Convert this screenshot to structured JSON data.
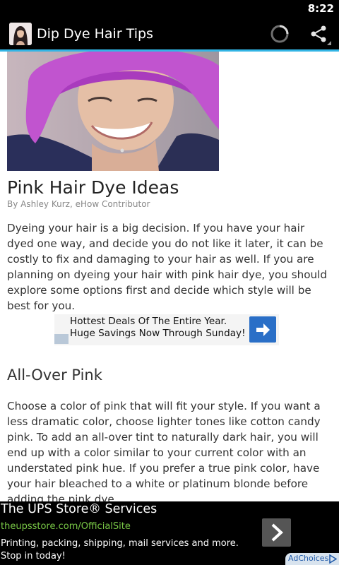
{
  "status_bar": {
    "time": "8:22"
  },
  "action_bar": {
    "title": "Dip Dye Hair Tips",
    "icons": {
      "app": "app-icon",
      "loading": "loading-spinner-icon",
      "share": "share-icon"
    },
    "accent_color": "#33b5e5"
  },
  "article": {
    "title": "Pink Hair Dye Ideas",
    "byline": "By Ashley Kurz, eHow Contributor",
    "paragraph1": "Dyeing your hair is a big decision. If you have your hair dyed one way, and decide you do not like it later, it can be costly to fix and damaging to your hair as well. If you are planning on dyeing your hair with pink hair dye, you should explore some options first and decide which style will be best for you.",
    "section_heading": "All-Over Pink",
    "paragraph2": "Choose a color of pink that will fit your style. If you want a less dramatic color, choose lighter tones like cotton candy pink. To add an all-over tint to naturally dark hair, you will end up with a color similar to your current color with an understated pink hue. If you prefer a true pink color, have your hair bleached to a white or platinum blonde before adding the pink dye."
  },
  "inline_ad": {
    "line1": "Hottest Deals Of The Entire Year.",
    "line2": "Huge Savings Now Through Sunday!",
    "button_icon": "arrow-right-icon"
  },
  "bottom_ad": {
    "title": "The UPS Store® Services",
    "url": "theupsstore.com/OfficialSite",
    "description": "Printing, packing, shipping, mail services and more. Stop in today!",
    "adchoices_label": "AdChoices",
    "url_color": "#79c846"
  }
}
